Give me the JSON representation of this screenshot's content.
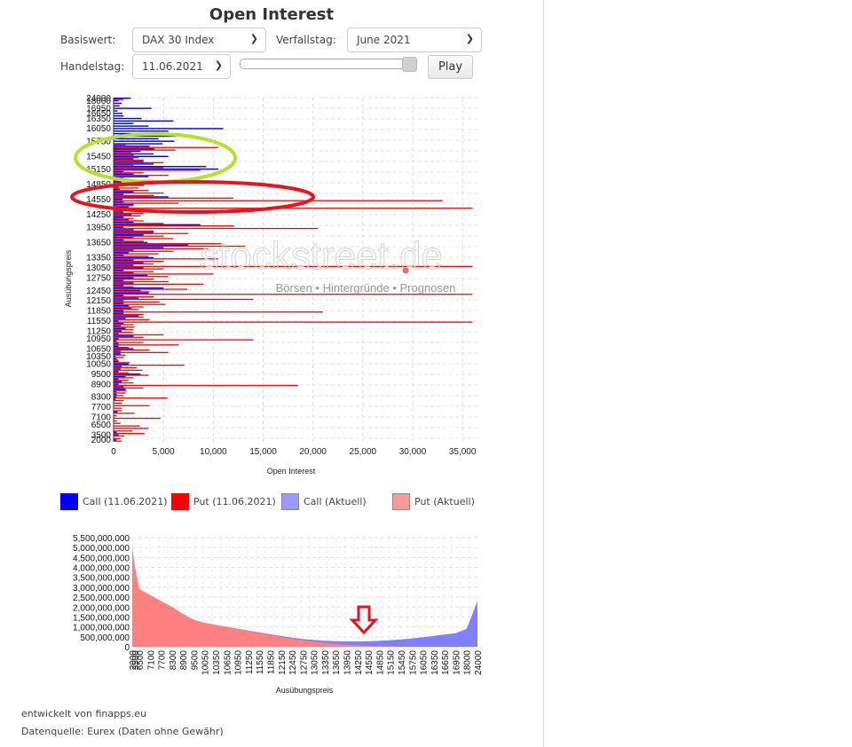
{
  "header": {
    "title": "Open Interest"
  },
  "controls": {
    "basiswert_label": "Basiswert:",
    "basiswert_value": "DAX 30 Index",
    "verfallstag_label": "Verfallstag:",
    "verfallstag_value": "June 2021",
    "handelstag_label": "Handelstag:",
    "handelstag_value": "11.06.2021",
    "slider_position_percent": 100,
    "play_label": "Play"
  },
  "watermark": {
    "logo": "stockstreet.de",
    "tagline": "Börsen • Hintergründe • Prognosen"
  },
  "colors": {
    "call": "#0000ff",
    "put": "#ff0000",
    "call_current": "#9999ff",
    "put_current": "#ff9999",
    "annotation_green": "#b5e02b",
    "annotation_red": "#e8141c"
  },
  "legend": [
    {
      "label": "Call (11.06.2021)",
      "color": "#0000ff"
    },
    {
      "label": "Put (11.06.2021)",
      "color": "#ff0000"
    },
    {
      "label": "Call (Aktuell)",
      "color": "#9999ff"
    },
    {
      "label": "Put (Aktuell)",
      "color": "#ff9999"
    }
  ],
  "chart_data": [
    {
      "type": "bar",
      "orientation": "horizontal",
      "xlabel": "Open Interest",
      "ylabel": "Ausübungspreis",
      "xlim": [
        0,
        36500
      ],
      "xticks": [
        0,
        5000,
        10000,
        15000,
        20000,
        25000,
        30000,
        35000
      ],
      "xtick_labels": [
        "0",
        "5,000",
        "10,000",
        "15,000",
        "20,000",
        "25,000",
        "30,000",
        "35,000"
      ],
      "grid": true,
      "ytick_labels": [
        "24000",
        "18000",
        "16950",
        "16650",
        "16350",
        "16050",
        "15750",
        "15450",
        "15150",
        "14850",
        "14550",
        "14250",
        "13950",
        "13650",
        "13350",
        "13050",
        "12750",
        "12450",
        "12150",
        "11850",
        "11550",
        "11250",
        "10950",
        "10650",
        "10350",
        "10050",
        "9500",
        "8900",
        "8300",
        "7700",
        "7100",
        "6500",
        "3500",
        "2000"
      ],
      "strikes": [
        24000,
        18000,
        17500,
        17000,
        16950,
        16800,
        16650,
        16500,
        16350,
        16250,
        16200,
        16100,
        16050,
        16000,
        15900,
        15850,
        15800,
        15750,
        15700,
        15650,
        15600,
        15550,
        15500,
        15450,
        15400,
        15300,
        15250,
        15200,
        15150,
        15100,
        15050,
        15000,
        14950,
        14900,
        14850,
        14800,
        14750,
        14700,
        14650,
        14600,
        14550,
        14500,
        14450,
        14400,
        14350,
        14300,
        14250,
        14200,
        14100,
        14050,
        14000,
        13950,
        13900,
        13850,
        13800,
        13750,
        13700,
        13650,
        13600,
        13550,
        13500,
        13450,
        13400,
        13350,
        13300,
        13200,
        13100,
        13050,
        13000,
        12900,
        12800,
        12750,
        12700,
        12600,
        12550,
        12500,
        12450,
        12400,
        12350,
        12300,
        12150,
        12100,
        12000,
        11900,
        11850,
        11800,
        11700,
        11600,
        11550,
        11500,
        11400,
        11300,
        11250,
        11150,
        11050,
        10950,
        10900,
        10800,
        10700,
        10650,
        10500,
        10400,
        10350,
        10250,
        10100,
        10050,
        10000,
        9800,
        9600,
        9500,
        9400,
        9200,
        9000,
        8900,
        8800,
        8700,
        8600,
        8500,
        8300,
        8200,
        8000,
        7800,
        7700,
        7600,
        7400,
        7200,
        7100,
        6800,
        6600,
        6500,
        6000,
        5000,
        4000,
        3500,
        3000,
        2000
      ],
      "series": [
        {
          "name": "Call (11.06.2021)",
          "values": [
            1700,
            500,
            800,
            600,
            3800,
            400,
            900,
            1000,
            2800,
            6000,
            2000,
            3500,
            11000,
            5500,
            5700,
            6300,
            4500,
            6100,
            4900,
            3600,
            4100,
            2700,
            4000,
            5500,
            2000,
            3000,
            4000,
            9300,
            10500,
            1000,
            2000,
            3500,
            1500,
            800,
            1000,
            500,
            600,
            2000,
            1000,
            5500,
            900,
            1000,
            2000,
            1500,
            1000,
            1000,
            1800,
            1000,
            1500,
            2000,
            8700,
            1000,
            2000,
            4000,
            3000,
            2000,
            1000,
            3400,
            7500,
            5000,
            2000,
            1500,
            1000,
            4000,
            2000,
            3000,
            2000,
            3000,
            1000,
            2000,
            3400,
            2000,
            1000,
            2000,
            1000,
            5000,
            2700,
            3500,
            1000,
            2500,
            1000,
            1000,
            1500,
            1800,
            1000,
            1000,
            2500,
            1200,
            500,
            1000,
            700,
            1200,
            800,
            500,
            2000,
            500,
            300,
            500,
            500,
            2000,
            700,
            700,
            200,
            300,
            500,
            1500,
            800,
            700,
            500,
            2700,
            1200,
            500,
            800,
            500,
            1000,
            1200,
            300,
            300,
            300,
            200,
            0,
            0,
            0,
            0,
            400,
            0,
            0,
            0,
            0,
            0,
            0,
            0,
            300,
            500,
            0,
            300,
            700
          ]
        },
        {
          "name": "Put (11.06.2021)",
          "values": [
            1000,
            0,
            0,
            0,
            0,
            0,
            0,
            0,
            0,
            0,
            0,
            0,
            0,
            0,
            0,
            0,
            0,
            0,
            1200,
            10500,
            6200,
            1800,
            2000,
            2500,
            3000,
            5000,
            2000,
            5000,
            8700,
            3000,
            5500,
            1000,
            4000,
            5500,
            3000,
            2500,
            3500,
            5000,
            4000,
            12000,
            33000,
            6500,
            2000,
            36000,
            5000,
            3000,
            2700,
            2000,
            3000,
            5000,
            12100,
            20500,
            4000,
            7500,
            5000,
            6000,
            3000,
            10800,
            13200,
            9500,
            6000,
            4500,
            3500,
            10500,
            5000,
            4000,
            36000,
            5000,
            4000,
            10000,
            5500,
            4000,
            5500,
            9000,
            2000,
            7400,
            3600,
            36000,
            4000,
            14000,
            4600,
            5200,
            3000,
            2500,
            21000,
            3000,
            3000,
            3600,
            36000,
            2000,
            2100,
            2000,
            1900,
            5000,
            3000,
            14000,
            3000,
            6500,
            1500,
            3600,
            5500,
            1200,
            1000,
            500,
            1600,
            7100,
            2300,
            2900,
            1500,
            3500,
            2000,
            1500,
            2000,
            18500,
            3000,
            1300,
            1200,
            1000,
            5400,
            1000,
            800,
            3600,
            800,
            800,
            2100,
            300,
            4700,
            300,
            700,
            2600,
            3500,
            1900,
            3100,
            1100,
            700,
            800
          ]
        }
      ]
    },
    {
      "type": "area",
      "stacked": true,
      "xlabel": "Ausübungspreis",
      "ylabel": "",
      "ylim": [
        0,
        5500000000
      ],
      "yticks": [
        0,
        500000000,
        1000000000,
        1500000000,
        2000000000,
        2500000000,
        3000000000,
        3500000000,
        4000000000,
        4500000000,
        5000000000,
        5500000000
      ],
      "ytick_labels": [
        "0",
        "500,000,000",
        "1,000,000,000",
        "1,500,000,000",
        "2,000,000,000",
        "2,500,000,000",
        "3,000,000,000",
        "3,500,000,000",
        "4,000,000,000",
        "4,500,000,000",
        "5,000,000,000",
        "5,500,000,000"
      ],
      "grid": true,
      "categories": [
        "2000",
        "3500",
        "6500",
        "7100",
        "7700",
        "8300",
        "8900",
        "9500",
        "10050",
        "10350",
        "10650",
        "10950",
        "11250",
        "11550",
        "11850",
        "12150",
        "12450",
        "12750",
        "13050",
        "13350",
        "13650",
        "13950",
        "14250",
        "14550",
        "14850",
        "15150",
        "15450",
        "15750",
        "16050",
        "16350",
        "16650",
        "16950",
        "18000",
        "24000"
      ],
      "series": [
        {
          "name": "Put (Aktuell)",
          "values": [
            5000000000,
            4000000000,
            2900000000,
            2600000000,
            2300000000,
            2000000000,
            1650000000,
            1350000000,
            1200000000,
            1100000000,
            1000000000,
            900000000,
            800000000,
            700000000,
            600000000,
            500000000,
            410000000,
            330000000,
            260000000,
            190000000,
            140000000,
            100000000,
            70000000,
            40000000,
            20000000,
            10000000,
            5000000,
            0,
            0,
            0,
            0,
            0,
            0,
            0
          ]
        },
        {
          "name": "Call (Aktuell)",
          "values": [
            0,
            0,
            0,
            0,
            0,
            0,
            0,
            0,
            0,
            0,
            5000000,
            10000000,
            15000000,
            20000000,
            30000000,
            50000000,
            50000000,
            60000000,
            80000000,
            110000000,
            140000000,
            170000000,
            200000000,
            240000000,
            280000000,
            320000000,
            365000000,
            420000000,
            480000000,
            550000000,
            620000000,
            680000000,
            900000000,
            2300000000
          ]
        }
      ]
    }
  ],
  "footer": {
    "line1": "entwickelt von finapps.eu",
    "line2": "Datenquelle: Eurex (Daten ohne Gewähr)"
  }
}
